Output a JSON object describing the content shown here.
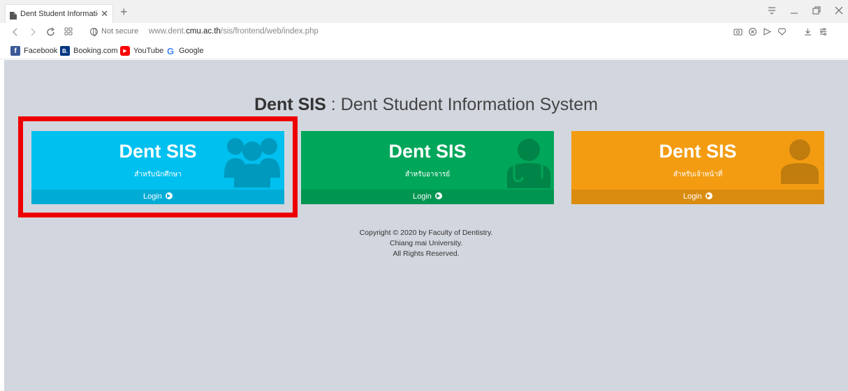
{
  "browser": {
    "tab_title": "Dent Student Information S",
    "tab_close": "✕",
    "new_tab": "+",
    "not_secure": "Not secure",
    "url_prefix": "www.dent.",
    "url_domain": "cmu.ac.th",
    "url_path": "/sis/frontend/web/index.php",
    "bookmarks": [
      {
        "label": "Facebook",
        "icon": "facebook-icon",
        "color": "#3b5998",
        "glyph": "f"
      },
      {
        "label": "Booking.com",
        "icon": "booking-icon",
        "color": "#003580",
        "glyph": "B."
      },
      {
        "label": "YouTube",
        "icon": "youtube-icon",
        "color": "#ff0000",
        "glyph": "▶"
      },
      {
        "label": "Google",
        "icon": "google-icon",
        "color": "#4285f4",
        "glyph": "G"
      }
    ]
  },
  "page": {
    "title_strong": "Dent SIS",
    "title_rest": " : Dent Student Information System",
    "boxes": [
      {
        "title": "Dent SIS",
        "subtitle": "สำหรับนักศึกษา",
        "login": "Login",
        "icon": "users-icon",
        "color": "#00c0ef"
      },
      {
        "title": "Dent SIS",
        "subtitle": "สำหรับอาจารย์",
        "login": "Login",
        "icon": "user-doctor-icon",
        "color": "#00a65a"
      },
      {
        "title": "Dent SIS",
        "subtitle": "สำหรับเจ้าหน้าที่",
        "login": "Login",
        "icon": "user-icon",
        "color": "#f39c12"
      }
    ],
    "copyright_lines": [
      "Copyright © 2020 by Faculty of Dentistry.",
      "Chiang mai University.",
      "All Rights Reserved."
    ]
  }
}
